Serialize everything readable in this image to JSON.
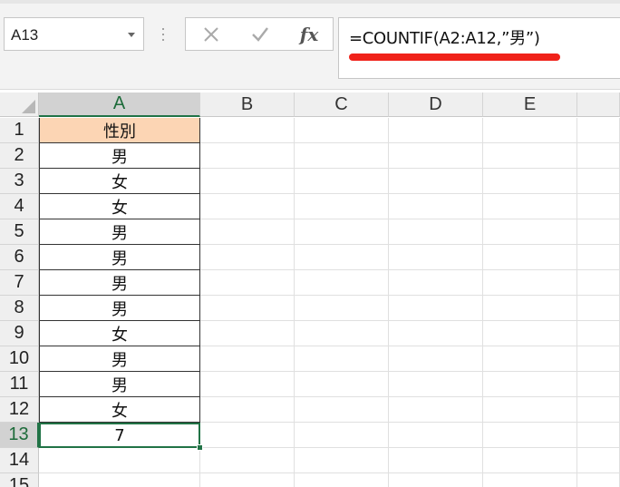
{
  "name_box": {
    "value": "A13"
  },
  "formula_bar": {
    "cancel_icon": "close-icon",
    "enter_icon": "check-icon",
    "fx_label": "fx",
    "formula": "=COUNTIF(A2:A12,”男”)"
  },
  "annotation": {
    "underline_color": "#f0221a"
  },
  "columns": [
    "A",
    "B",
    "C",
    "D",
    "E"
  ],
  "rows": [
    "1",
    "2",
    "3",
    "4",
    "5",
    "6",
    "7",
    "8",
    "9",
    "10",
    "11",
    "12",
    "13",
    "14",
    "15"
  ],
  "cells": {
    "A1": "性別",
    "A2": "男",
    "A3": "女",
    "A4": "女",
    "A5": "男",
    "A6": "男",
    "A7": "男",
    "A8": "男",
    "A9": "女",
    "A10": "男",
    "A11": "男",
    "A12": "女",
    "A13": "7"
  },
  "selection": {
    "active_cell": "A13",
    "accent_color": "#217346"
  },
  "header_fill": "#fcd5b4"
}
